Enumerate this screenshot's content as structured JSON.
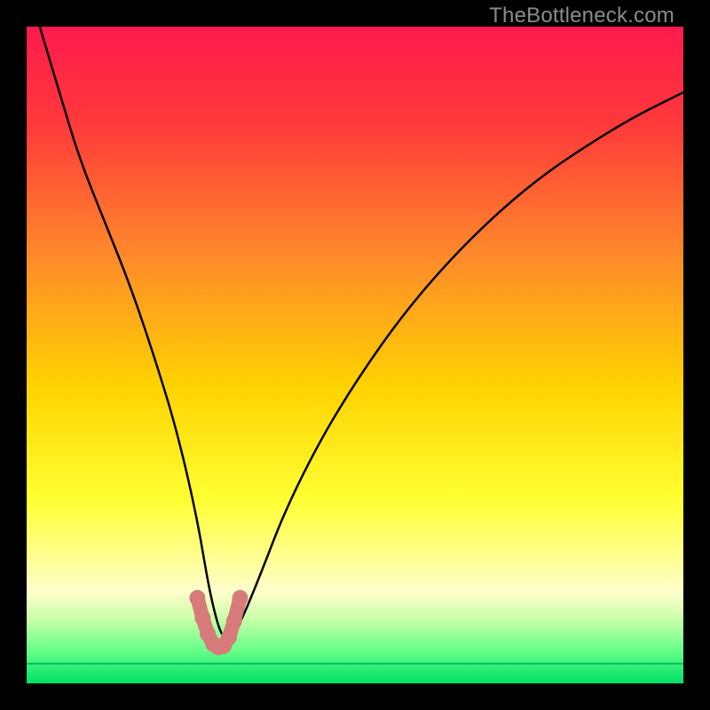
{
  "watermark": "TheBottleneck.com",
  "chart_data": {
    "type": "line",
    "title": "",
    "xlabel": "",
    "ylabel": "",
    "xlim": [
      0,
      100
    ],
    "ylim": [
      0,
      100
    ],
    "grid": false,
    "gradient_stops": [
      {
        "offset": 0,
        "color": "#ff1a4d"
      },
      {
        "offset": 0.15,
        "color": "#ff3a3a"
      },
      {
        "offset": 0.35,
        "color": "#ff8a2a"
      },
      {
        "offset": 0.55,
        "color": "#ffd300"
      },
      {
        "offset": 0.72,
        "color": "#ffff33"
      },
      {
        "offset": 0.8,
        "color": "#ffff88"
      },
      {
        "offset": 0.86,
        "color": "#ffffcc"
      },
      {
        "offset": 0.9,
        "color": "#ccffaa"
      },
      {
        "offset": 0.95,
        "color": "#66ff88"
      },
      {
        "offset": 1.0,
        "color": "#00e066"
      }
    ],
    "series": [
      {
        "name": "bottleneck-curve",
        "stroke": "#000000",
        "x": [
          2,
          5,
          8,
          12,
          16,
          20,
          23,
          26,
          28,
          30,
          32,
          35,
          40,
          48,
          60,
          75,
          90,
          100
        ],
        "values": [
          100,
          90,
          80,
          70,
          60,
          48,
          38,
          25,
          13,
          6,
          8,
          15,
          28,
          43,
          60,
          75,
          85,
          90
        ]
      }
    ],
    "markers": {
      "name": "highlight-dots",
      "fill": "#d77a7a",
      "x": [
        26.0,
        26.8,
        27.6,
        28.4,
        29.2,
        30.0,
        30.8,
        31.6,
        32.5
      ],
      "y": [
        13.0,
        10.0,
        7.5,
        6.0,
        5.5,
        5.7,
        7.0,
        9.5,
        13.0
      ]
    },
    "floor_line": {
      "name": "green-floor",
      "y": 3,
      "stroke": "#00c060"
    }
  }
}
